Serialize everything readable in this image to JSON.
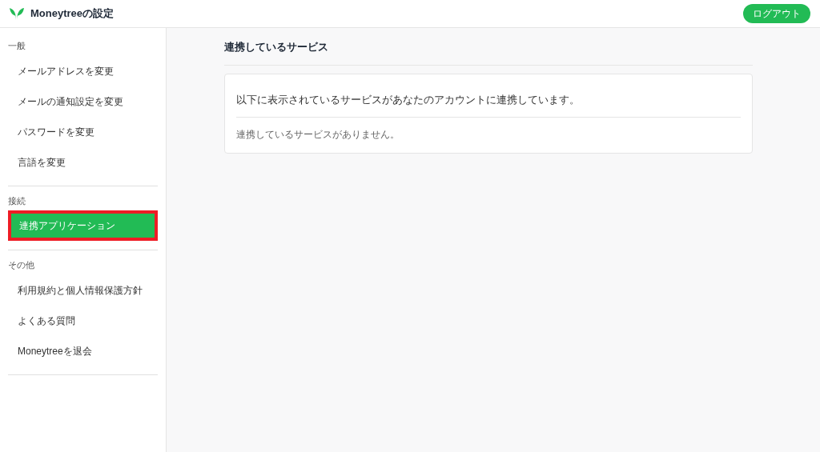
{
  "header": {
    "title": "Moneytreeの設定",
    "logout": "ログアウト"
  },
  "sidebar": {
    "sections": [
      {
        "heading": "一般",
        "items": [
          {
            "label": "メールアドレスを変更",
            "selected": false
          },
          {
            "label": "メールの通知設定を変更",
            "selected": false
          },
          {
            "label": "パスワードを変更",
            "selected": false
          },
          {
            "label": "言語を変更",
            "selected": false
          }
        ]
      },
      {
        "heading": "接続",
        "items": [
          {
            "label": "連携アプリケーション",
            "selected": true
          }
        ]
      },
      {
        "heading": "その他",
        "items": [
          {
            "label": "利用規約と個人情報保護方針",
            "selected": false
          },
          {
            "label": "よくある質問",
            "selected": false
          },
          {
            "label": "Moneytreeを退会",
            "selected": false
          }
        ]
      }
    ]
  },
  "main": {
    "title": "連携しているサービス",
    "card": {
      "description": "以下に表示されているサービスがあなたのアカウントに連携しています。",
      "empty": "連携しているサービスがありません。"
    }
  }
}
